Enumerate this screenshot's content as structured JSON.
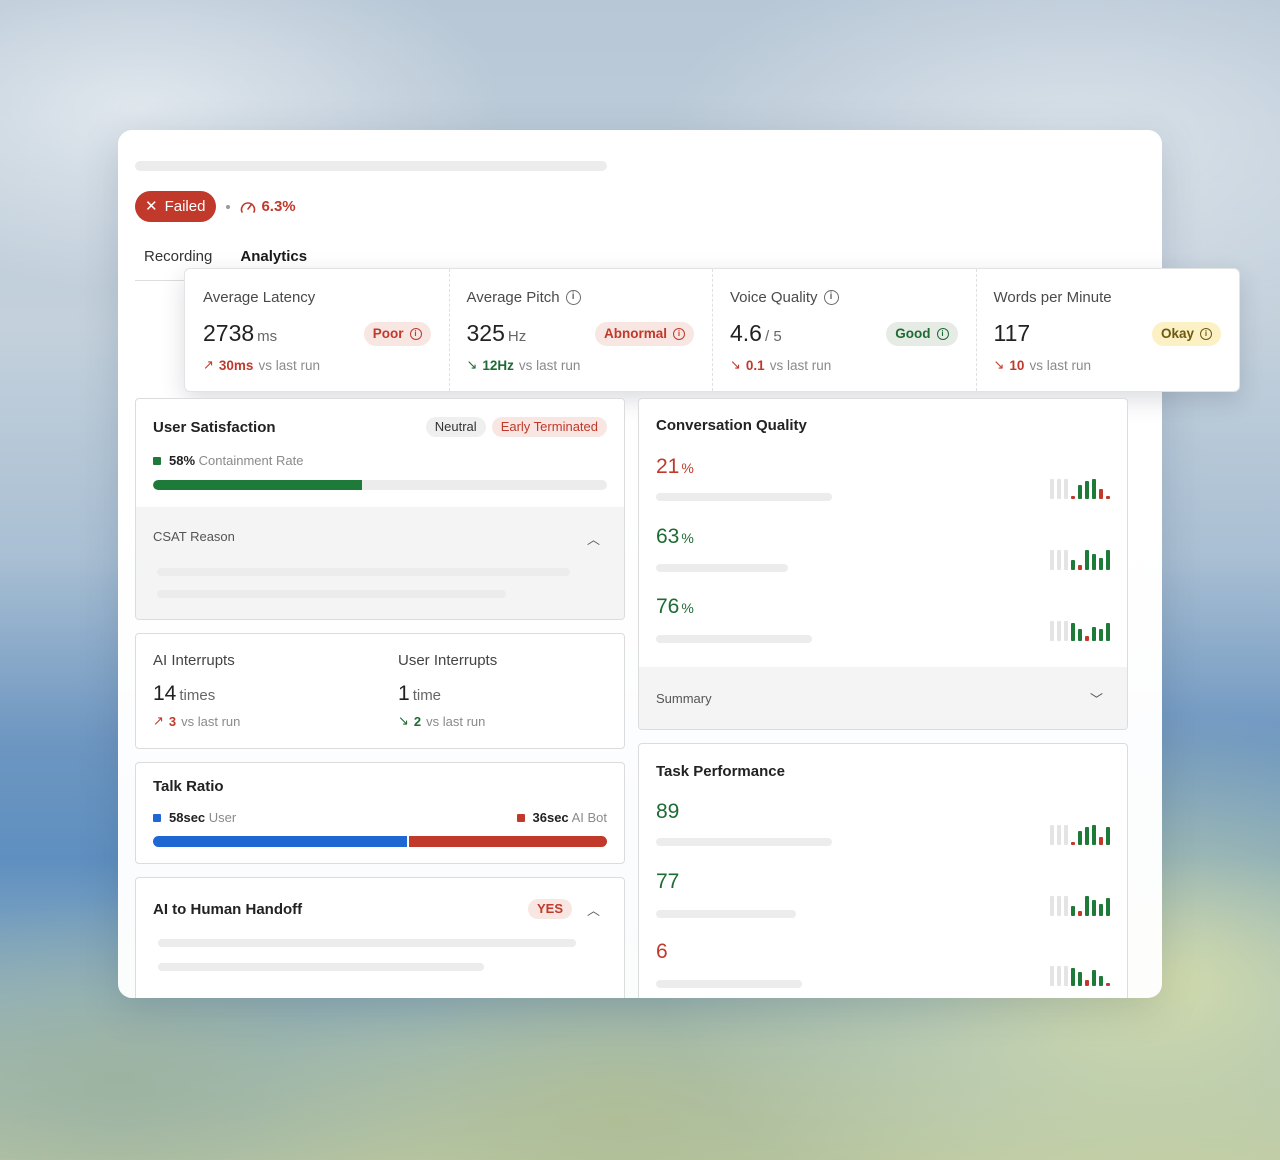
{
  "status": {
    "label": "Failed",
    "score": "6.3%"
  },
  "tabs": [
    {
      "label": "Recording"
    },
    {
      "label": "Analytics"
    }
  ],
  "metrics": [
    {
      "title": "Average Latency",
      "value": "2738",
      "unit": "ms",
      "badge": "Poor",
      "delta": "30ms",
      "delta_note": "vs last run"
    },
    {
      "title": "Average Pitch",
      "value": "325",
      "unit": "Hz",
      "badge": "Abnormal",
      "delta": "12Hz",
      "delta_note": "vs last run"
    },
    {
      "title": "Voice Quality",
      "value": "4.6",
      "unit": "/ 5",
      "badge": "Good",
      "delta": "0.1",
      "delta_note": "vs last run"
    },
    {
      "title": "Words per Minute",
      "value": "117",
      "unit": "",
      "badge": "Okay",
      "delta": "10",
      "delta_note": "vs last run"
    }
  ],
  "user_satisfaction": {
    "title": "User Satisfaction",
    "tags": [
      "Neutral",
      "Early Terminated"
    ],
    "containment_value": "58%",
    "containment_label": "Containment Rate",
    "containment_fraction": 0.46,
    "csat_label": "CSAT Reason"
  },
  "interrupts": {
    "ai": {
      "title": "AI Interrupts",
      "value": "14",
      "unit": "times",
      "delta": "3",
      "delta_note": "vs last run"
    },
    "user": {
      "title": "User Interrupts",
      "value": "1",
      "unit": "time",
      "delta": "2",
      "delta_note": "vs last run"
    }
  },
  "talk_ratio": {
    "title": "Talk Ratio",
    "user_value": "58sec",
    "user_label": "User",
    "bot_value": "36sec",
    "bot_label": "AI Bot",
    "user_fraction": 0.56
  },
  "handoff": {
    "title": "AI to Human Handoff",
    "value": "YES"
  },
  "conversation_quality": {
    "title": "Conversation Quality",
    "rows": [
      {
        "value": "21",
        "unit": "%"
      },
      {
        "value": "63",
        "unit": "%"
      },
      {
        "value": "76",
        "unit": "%"
      }
    ],
    "summary_label": "Summary"
  },
  "task_performance": {
    "title": "Task Performance",
    "rows": [
      {
        "value": "89"
      },
      {
        "value": "77"
      },
      {
        "value": "6"
      }
    ]
  },
  "colors": {
    "fail": "#c0392b",
    "success": "#1e7a38",
    "user": "#1f67d2"
  },
  "icons": [
    "close-icon",
    "gauge-icon",
    "info-icon",
    "trend-up-icon",
    "trend-down-icon",
    "chevron-up-icon",
    "chevron-down-icon"
  ]
}
